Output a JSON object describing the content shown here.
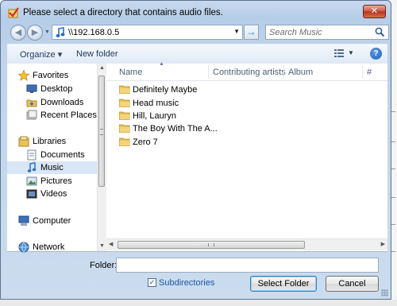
{
  "window": {
    "title": "Please select a directory that contains audio files.",
    "close_label": "✕"
  },
  "address": {
    "path": "\\\\192.168.0.5"
  },
  "search": {
    "placeholder": "Search Music"
  },
  "toolbar": {
    "organize_label": "Organize ▾",
    "new_folder_label": "New folder",
    "help_label": "?"
  },
  "sidebar": {
    "items": [
      {
        "label": "Favorites",
        "icon": "star-icon"
      },
      {
        "label": "Desktop",
        "icon": "desktop-icon"
      },
      {
        "label": "Downloads",
        "icon": "downloads-icon"
      },
      {
        "label": "Recent Places",
        "icon": "recent-places-icon"
      },
      {
        "label": "Libraries",
        "icon": "libraries-icon"
      },
      {
        "label": "Documents",
        "icon": "documents-icon"
      },
      {
        "label": "Music",
        "icon": "music-icon",
        "selected": true
      },
      {
        "label": "Pictures",
        "icon": "pictures-icon"
      },
      {
        "label": "Videos",
        "icon": "videos-icon"
      },
      {
        "label": "Computer",
        "icon": "computer-icon"
      },
      {
        "label": "Network",
        "icon": "network-icon"
      }
    ]
  },
  "columns": [
    {
      "label": "Name"
    },
    {
      "label": "Contributing artists"
    },
    {
      "label": "Album"
    },
    {
      "label": "#"
    }
  ],
  "files": [
    {
      "name": "Definitely Maybe"
    },
    {
      "name": "Head music"
    },
    {
      "name": "Hill, Lauryn"
    },
    {
      "name": "The Boy With The A..."
    },
    {
      "name": "Zero 7"
    }
  ],
  "footer": {
    "folder_label": "Folder:",
    "folder_value": "",
    "subdirectories_label": "Subdirectories",
    "subdirectories_checked": true,
    "select_button": "Select Folder",
    "cancel_button": "Cancel"
  },
  "colors": {
    "accent": "#3c7fb1",
    "selection": "#d9e6f6",
    "link": "#1a55a6"
  }
}
